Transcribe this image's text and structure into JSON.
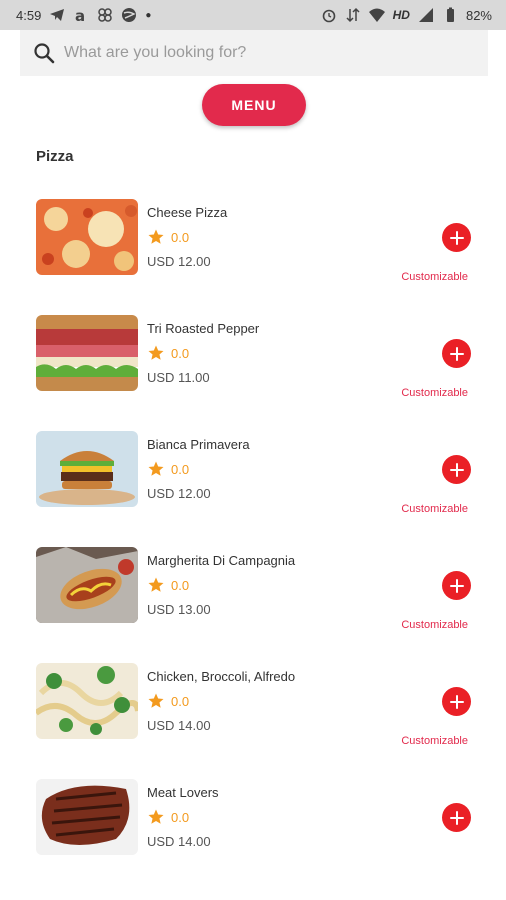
{
  "status_bar": {
    "time": "4:59",
    "network": "HD",
    "battery": "82%"
  },
  "search": {
    "placeholder": "What are you looking for?"
  },
  "menu_button": {
    "label": "MENU"
  },
  "section": {
    "title": "Pizza"
  },
  "colors": {
    "accent": "#e22a4c",
    "add_button": "#ea2026",
    "rating": "#f39a1e"
  },
  "items": [
    {
      "name": "Cheese Pizza",
      "rating": "0.0",
      "price": "USD 12.00",
      "customizable": "Customizable",
      "image": "pizza"
    },
    {
      "name": "Tri Roasted Pepper",
      "rating": "0.0",
      "price": "USD 11.00",
      "customizable": "Customizable",
      "image": "sandwich"
    },
    {
      "name": "Bianca Primavera",
      "rating": "0.0",
      "price": "USD 12.00",
      "customizable": "Customizable",
      "image": "burger"
    },
    {
      "name": "Margherita Di Campagnia",
      "rating": "0.0",
      "price": "USD 13.00",
      "customizable": "Customizable",
      "image": "hotdog"
    },
    {
      "name": "Chicken, Broccoli, Alfredo",
      "rating": "0.0",
      "price": "USD 14.00",
      "customizable": "Customizable",
      "image": "pasta"
    },
    {
      "name": "Meat Lovers",
      "rating": "0.0",
      "price": "USD 14.00",
      "customizable": "",
      "image": "steak"
    }
  ]
}
